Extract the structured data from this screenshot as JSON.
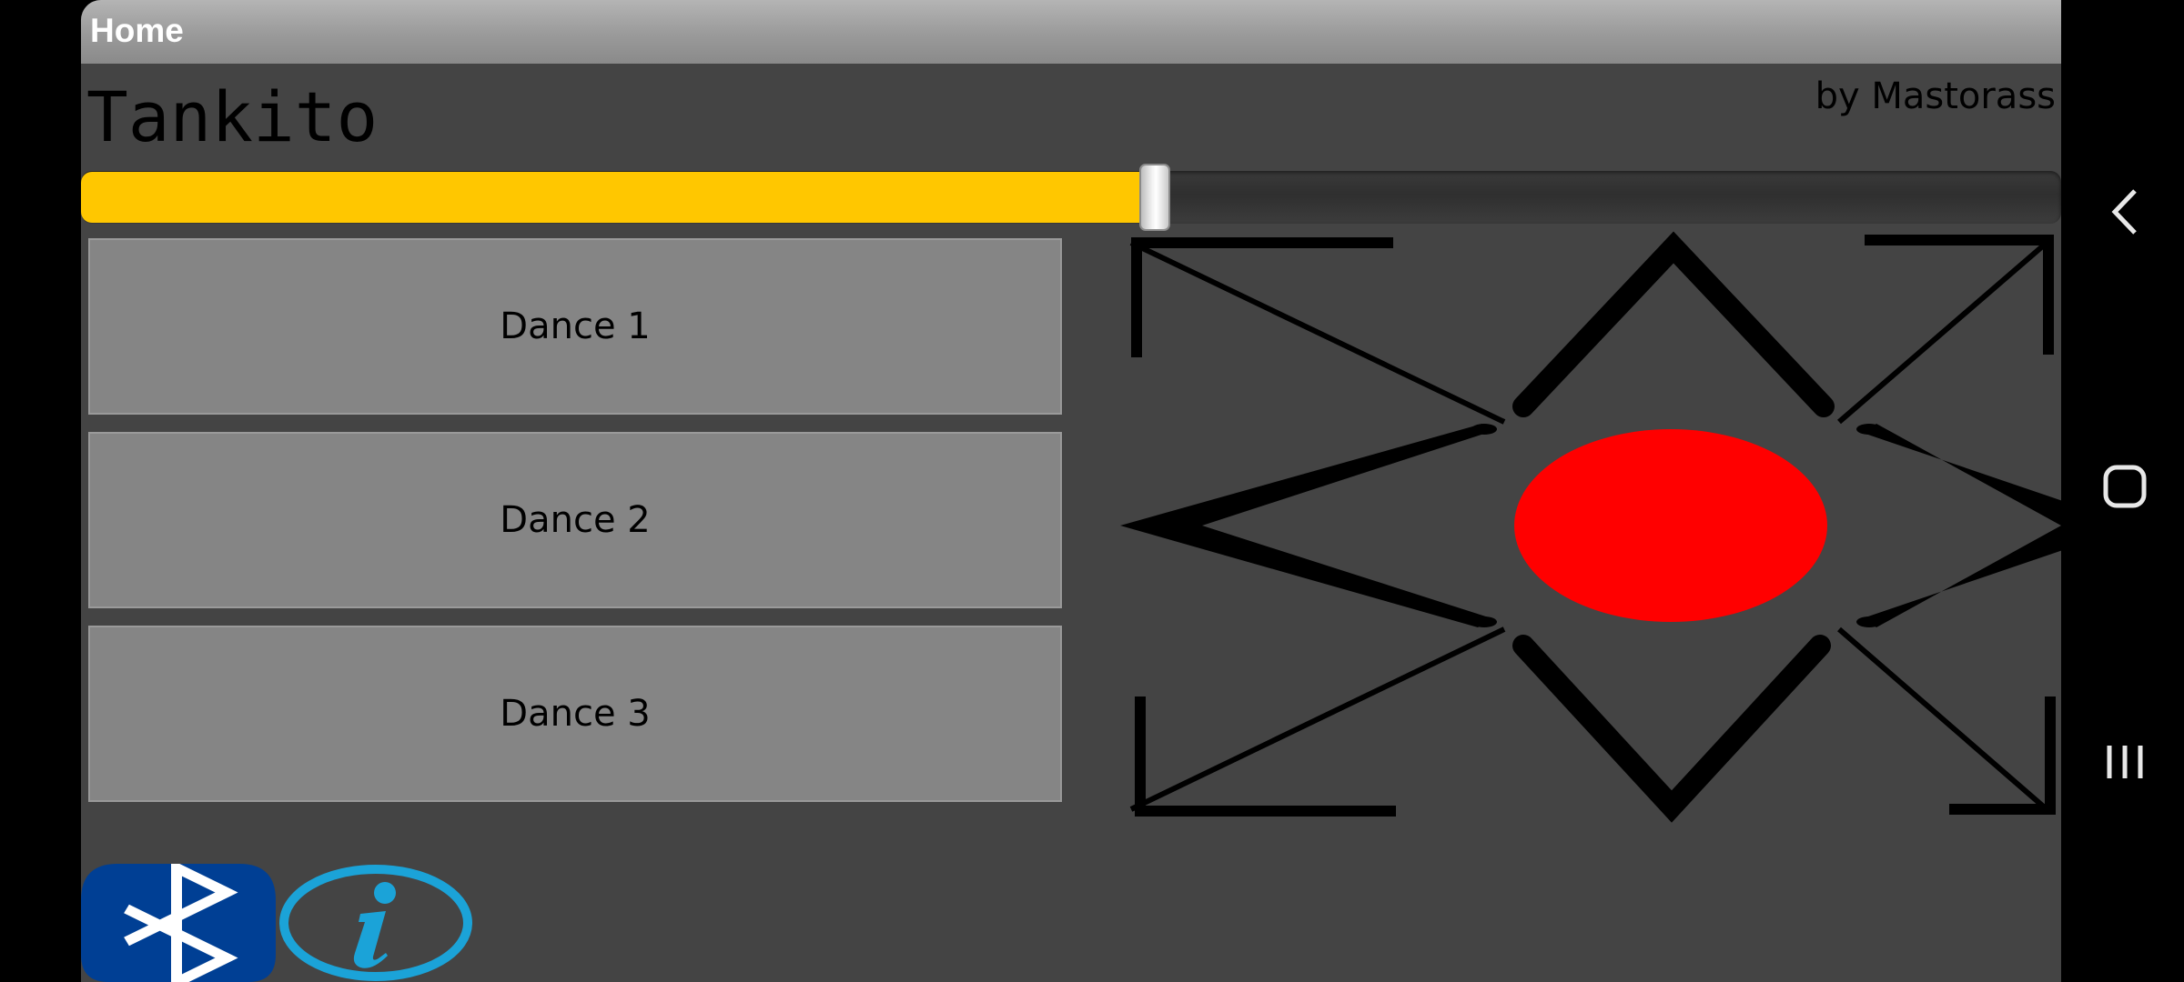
{
  "titlebar": {
    "title": "Home"
  },
  "header": {
    "app_name": "Tankito",
    "byline": "by Mastorass"
  },
  "speed_slider": {
    "value_fraction": 0.5
  },
  "dance_buttons": [
    {
      "label": "Dance 1"
    },
    {
      "label": "Dance 2"
    },
    {
      "label": "Dance 3"
    }
  ],
  "control_pad": {
    "center_color": "#ff0000",
    "arrows": [
      "forward",
      "backward",
      "left",
      "right",
      "forward-left",
      "forward-right",
      "backward-left",
      "backward-right"
    ]
  },
  "bottom_bar": {
    "bluetooth": {
      "icon": "bluetooth-icon",
      "color": "#003f94"
    },
    "info": {
      "icon": "info-icon",
      "color": "#1ba3d8"
    }
  },
  "system_nav": {
    "back": "back-icon",
    "home": "home-icon",
    "recents": "recents-icon"
  },
  "colors": {
    "background": "#444444",
    "slider_fill": "#ffc700",
    "button": "#858585"
  }
}
